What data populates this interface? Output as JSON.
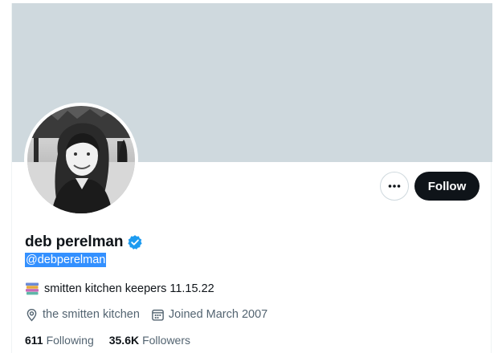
{
  "profile": {
    "display_name": "deb perelman",
    "handle": "@debperelman",
    "bio": "smitten kitchen keepers 11.15.22",
    "location_text": "the smitten kitchen",
    "joined_text": "Joined March 2007"
  },
  "actions": {
    "follow_label": "Follow"
  },
  "stats": {
    "following_count": "611",
    "following_label": "Following",
    "followers_count": "35.6K",
    "followers_label": "Followers"
  },
  "icons": {
    "verified": "verified-badge-icon",
    "more": "more-icon",
    "bio_emoji": "books-icon",
    "location": "location-pin-icon",
    "calendar": "calendar-icon"
  },
  "colors": {
    "banner": "#cfd9de",
    "follow_button": "#0f1419",
    "verified": "#1d9bf0",
    "secondary_text": "#536471",
    "selection_highlight": "#3390ff"
  }
}
